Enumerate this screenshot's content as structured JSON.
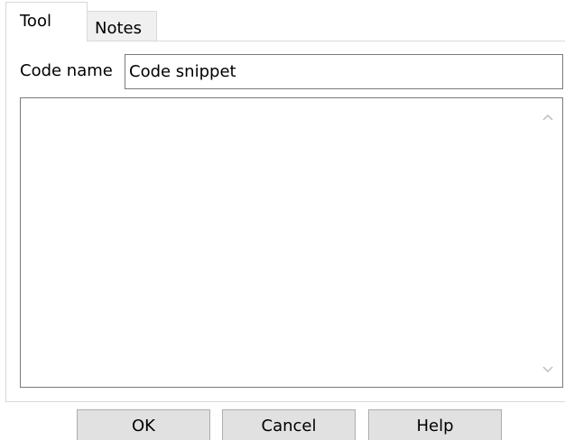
{
  "tabs": [
    {
      "label": "Tool",
      "active": true
    },
    {
      "label": "Notes",
      "active": false
    }
  ],
  "form": {
    "code_name_label": "Code name",
    "code_name_value": "Code snippet",
    "code_text": ""
  },
  "buttons": {
    "ok": "OK",
    "cancel": "Cancel",
    "help": "Help"
  },
  "icons": {
    "scroll_up": "chevron-up-icon",
    "scroll_down": "chevron-down-icon"
  },
  "colors": {
    "button_face": "#e1e1e1",
    "field_border": "#7a7a7a",
    "inactive_tab": "#f0f0f0"
  }
}
